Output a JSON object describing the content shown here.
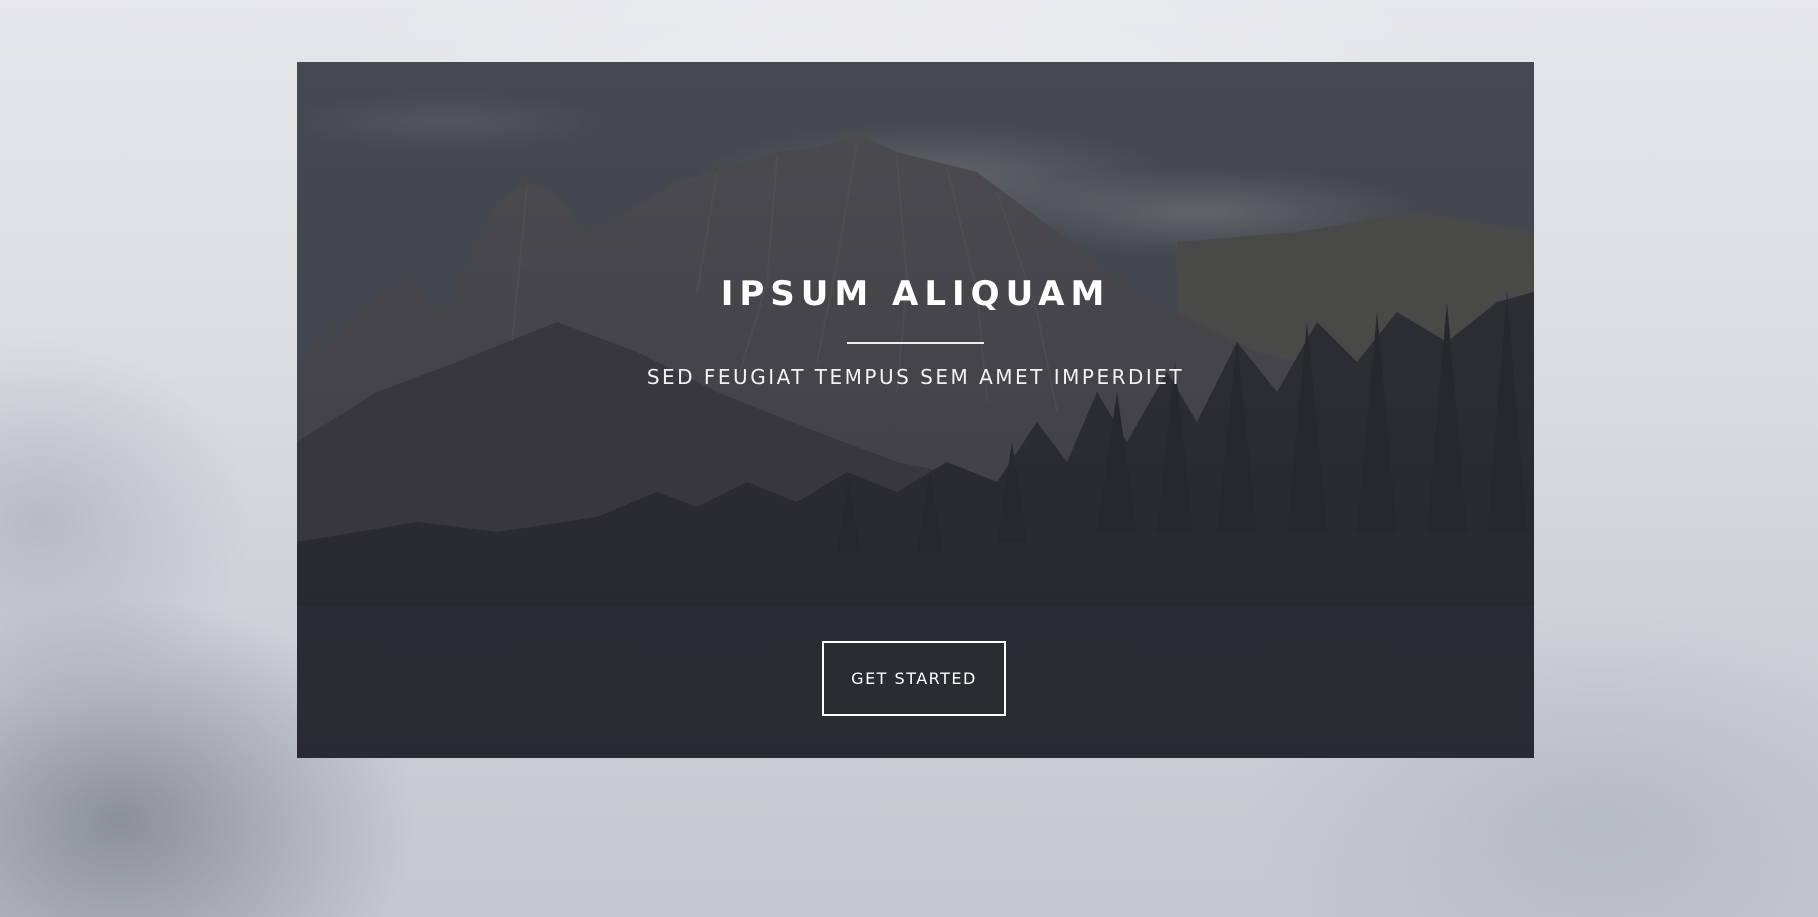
{
  "hero": {
    "title": "IPSUM ALIQUAM",
    "subtitle": "SED FEUGIAT TEMPUS SEM AMET IMPERDIET",
    "cta_label": "GET STARTED"
  },
  "colors": {
    "page_background": "#dcdee2",
    "card_overlay": "#2e2f37",
    "text": "#ffffff"
  }
}
